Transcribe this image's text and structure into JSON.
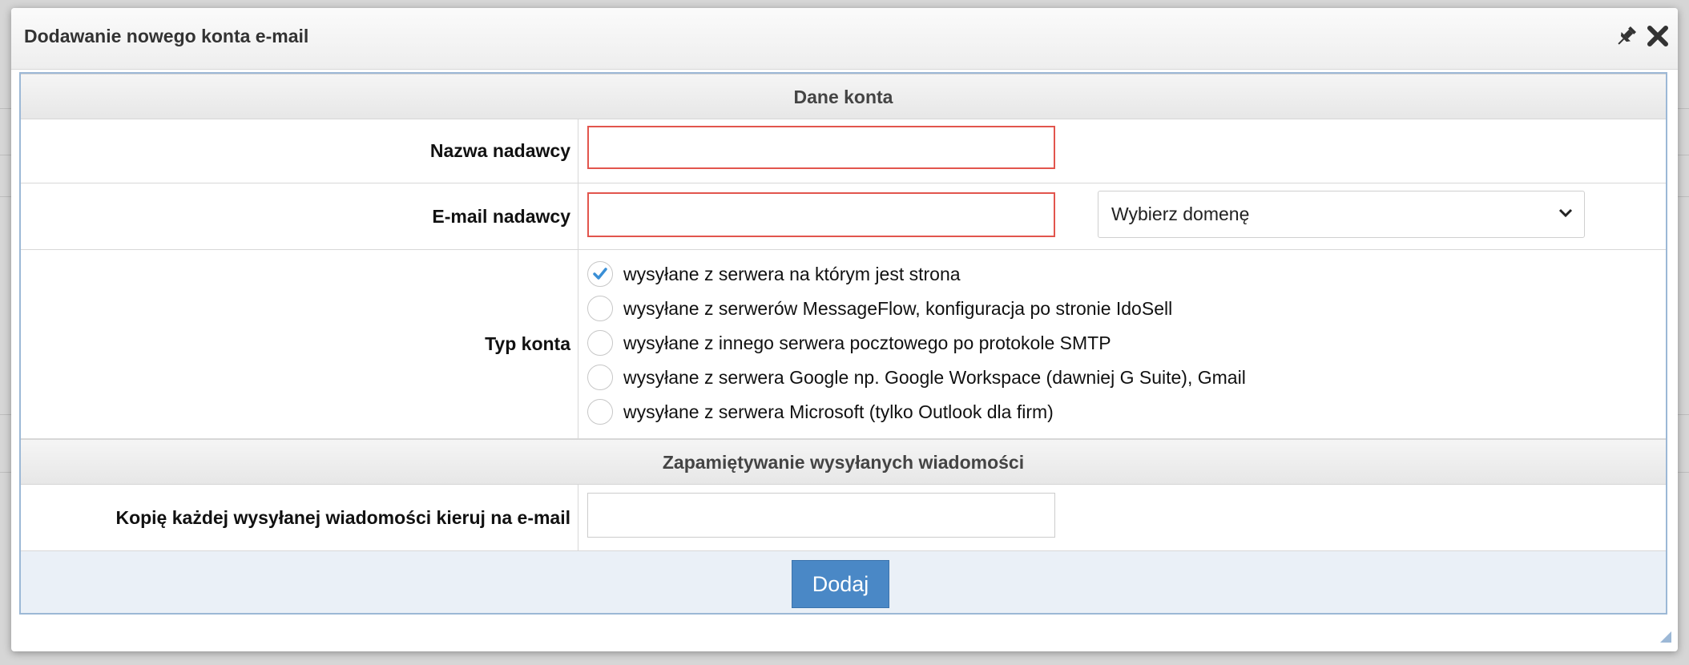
{
  "dialog": {
    "title": "Dodawanie nowego konta e-mail",
    "pin_icon": "pin-icon",
    "close_icon": "close-icon"
  },
  "sections": {
    "account_data": "Dane konta",
    "remember_sent": "Zapamiętywanie wysyłanych wiadomości"
  },
  "fields": {
    "sender_name": {
      "label": "Nazwa nadawcy",
      "value": ""
    },
    "sender_email": {
      "label": "E-mail nadawcy",
      "value": ""
    },
    "domain_select": {
      "selected": "Wybierz domenę"
    },
    "account_type": {
      "label": "Typ konta",
      "options": [
        {
          "label": "wysyłane z serwera na którym jest strona",
          "checked": true
        },
        {
          "label": "wysyłane z serwerów MessageFlow, konfiguracja po stronie IdoSell",
          "checked": false
        },
        {
          "label": "wysyłane z innego serwera pocztowego po protokole SMTP",
          "checked": false
        },
        {
          "label": "wysyłane z serwera Google np. Google Workspace (dawniej G Suite), Gmail",
          "checked": false
        },
        {
          "label": "wysyłane z serwera Microsoft (tylko Outlook dla firm)",
          "checked": false
        }
      ]
    },
    "copy_email": {
      "label": "Kopię każdej wysyłanej wiadomości kieruj na e-mail",
      "value": ""
    }
  },
  "actions": {
    "add_label": "Dodaj"
  },
  "colors": {
    "accent_button": "#4a88c6",
    "invalid_border": "#e2554d",
    "panel_border": "#9cb8d6",
    "checkmark": "#3a8fd6"
  }
}
